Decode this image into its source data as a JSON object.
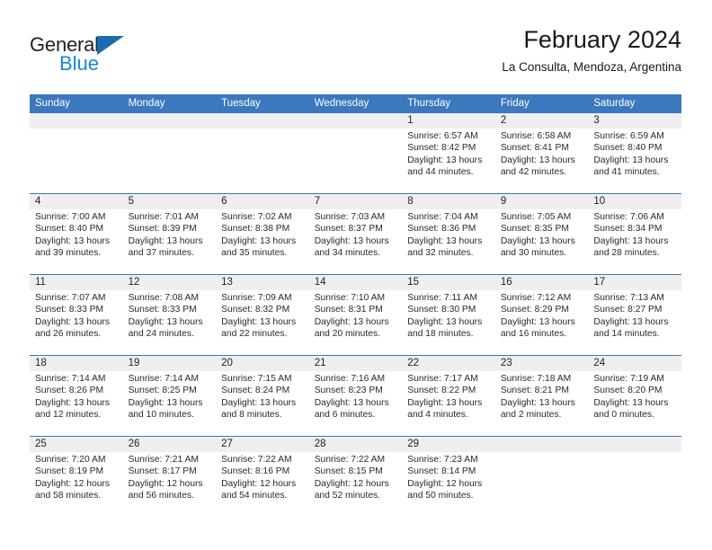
{
  "brand": {
    "name_part1": "General",
    "name_part2": "Blue",
    "triangle_icon": "brand-triangle-icon",
    "colors": {
      "dark": "#231f20",
      "blue": "#1b87d6",
      "triangle": "#1b6cb3"
    }
  },
  "header": {
    "title": "February 2024",
    "subtitle": "La Consulta, Mendoza, Argentina"
  },
  "theme": {
    "header_blue": "#3b78bd",
    "daynum_band": "#efefef",
    "grid_line": "#3b78bd"
  },
  "weekdays": [
    "Sunday",
    "Monday",
    "Tuesday",
    "Wednesday",
    "Thursday",
    "Friday",
    "Saturday"
  ],
  "weeks": [
    [
      {
        "day": "",
        "empty": true
      },
      {
        "day": "",
        "empty": true
      },
      {
        "day": "",
        "empty": true
      },
      {
        "day": "",
        "empty": true
      },
      {
        "day": "1",
        "sunrise": "Sunrise: 6:57 AM",
        "sunset": "Sunset: 8:42 PM",
        "daylight1": "Daylight: 13 hours",
        "daylight2": "and 44 minutes."
      },
      {
        "day": "2",
        "sunrise": "Sunrise: 6:58 AM",
        "sunset": "Sunset: 8:41 PM",
        "daylight1": "Daylight: 13 hours",
        "daylight2": "and 42 minutes."
      },
      {
        "day": "3",
        "sunrise": "Sunrise: 6:59 AM",
        "sunset": "Sunset: 8:40 PM",
        "daylight1": "Daylight: 13 hours",
        "daylight2": "and 41 minutes."
      }
    ],
    [
      {
        "day": "4",
        "sunrise": "Sunrise: 7:00 AM",
        "sunset": "Sunset: 8:40 PM",
        "daylight1": "Daylight: 13 hours",
        "daylight2": "and 39 minutes."
      },
      {
        "day": "5",
        "sunrise": "Sunrise: 7:01 AM",
        "sunset": "Sunset: 8:39 PM",
        "daylight1": "Daylight: 13 hours",
        "daylight2": "and 37 minutes."
      },
      {
        "day": "6",
        "sunrise": "Sunrise: 7:02 AM",
        "sunset": "Sunset: 8:38 PM",
        "daylight1": "Daylight: 13 hours",
        "daylight2": "and 35 minutes."
      },
      {
        "day": "7",
        "sunrise": "Sunrise: 7:03 AM",
        "sunset": "Sunset: 8:37 PM",
        "daylight1": "Daylight: 13 hours",
        "daylight2": "and 34 minutes."
      },
      {
        "day": "8",
        "sunrise": "Sunrise: 7:04 AM",
        "sunset": "Sunset: 8:36 PM",
        "daylight1": "Daylight: 13 hours",
        "daylight2": "and 32 minutes."
      },
      {
        "day": "9",
        "sunrise": "Sunrise: 7:05 AM",
        "sunset": "Sunset: 8:35 PM",
        "daylight1": "Daylight: 13 hours",
        "daylight2": "and 30 minutes."
      },
      {
        "day": "10",
        "sunrise": "Sunrise: 7:06 AM",
        "sunset": "Sunset: 8:34 PM",
        "daylight1": "Daylight: 13 hours",
        "daylight2": "and 28 minutes."
      }
    ],
    [
      {
        "day": "11",
        "sunrise": "Sunrise: 7:07 AM",
        "sunset": "Sunset: 8:33 PM",
        "daylight1": "Daylight: 13 hours",
        "daylight2": "and 26 minutes."
      },
      {
        "day": "12",
        "sunrise": "Sunrise: 7:08 AM",
        "sunset": "Sunset: 8:33 PM",
        "daylight1": "Daylight: 13 hours",
        "daylight2": "and 24 minutes."
      },
      {
        "day": "13",
        "sunrise": "Sunrise: 7:09 AM",
        "sunset": "Sunset: 8:32 PM",
        "daylight1": "Daylight: 13 hours",
        "daylight2": "and 22 minutes."
      },
      {
        "day": "14",
        "sunrise": "Sunrise: 7:10 AM",
        "sunset": "Sunset: 8:31 PM",
        "daylight1": "Daylight: 13 hours",
        "daylight2": "and 20 minutes."
      },
      {
        "day": "15",
        "sunrise": "Sunrise: 7:11 AM",
        "sunset": "Sunset: 8:30 PM",
        "daylight1": "Daylight: 13 hours",
        "daylight2": "and 18 minutes."
      },
      {
        "day": "16",
        "sunrise": "Sunrise: 7:12 AM",
        "sunset": "Sunset: 8:29 PM",
        "daylight1": "Daylight: 13 hours",
        "daylight2": "and 16 minutes."
      },
      {
        "day": "17",
        "sunrise": "Sunrise: 7:13 AM",
        "sunset": "Sunset: 8:27 PM",
        "daylight1": "Daylight: 13 hours",
        "daylight2": "and 14 minutes."
      }
    ],
    [
      {
        "day": "18",
        "sunrise": "Sunrise: 7:14 AM",
        "sunset": "Sunset: 8:26 PM",
        "daylight1": "Daylight: 13 hours",
        "daylight2": "and 12 minutes."
      },
      {
        "day": "19",
        "sunrise": "Sunrise: 7:14 AM",
        "sunset": "Sunset: 8:25 PM",
        "daylight1": "Daylight: 13 hours",
        "daylight2": "and 10 minutes."
      },
      {
        "day": "20",
        "sunrise": "Sunrise: 7:15 AM",
        "sunset": "Sunset: 8:24 PM",
        "daylight1": "Daylight: 13 hours",
        "daylight2": "and 8 minutes."
      },
      {
        "day": "21",
        "sunrise": "Sunrise: 7:16 AM",
        "sunset": "Sunset: 8:23 PM",
        "daylight1": "Daylight: 13 hours",
        "daylight2": "and 6 minutes."
      },
      {
        "day": "22",
        "sunrise": "Sunrise: 7:17 AM",
        "sunset": "Sunset: 8:22 PM",
        "daylight1": "Daylight: 13 hours",
        "daylight2": "and 4 minutes."
      },
      {
        "day": "23",
        "sunrise": "Sunrise: 7:18 AM",
        "sunset": "Sunset: 8:21 PM",
        "daylight1": "Daylight: 13 hours",
        "daylight2": "and 2 minutes."
      },
      {
        "day": "24",
        "sunrise": "Sunrise: 7:19 AM",
        "sunset": "Sunset: 8:20 PM",
        "daylight1": "Daylight: 13 hours",
        "daylight2": "and 0 minutes."
      }
    ],
    [
      {
        "day": "25",
        "sunrise": "Sunrise: 7:20 AM",
        "sunset": "Sunset: 8:19 PM",
        "daylight1": "Daylight: 12 hours",
        "daylight2": "and 58 minutes."
      },
      {
        "day": "26",
        "sunrise": "Sunrise: 7:21 AM",
        "sunset": "Sunset: 8:17 PM",
        "daylight1": "Daylight: 12 hours",
        "daylight2": "and 56 minutes."
      },
      {
        "day": "27",
        "sunrise": "Sunrise: 7:22 AM",
        "sunset": "Sunset: 8:16 PM",
        "daylight1": "Daylight: 12 hours",
        "daylight2": "and 54 minutes."
      },
      {
        "day": "28",
        "sunrise": "Sunrise: 7:22 AM",
        "sunset": "Sunset: 8:15 PM",
        "daylight1": "Daylight: 12 hours",
        "daylight2": "and 52 minutes."
      },
      {
        "day": "29",
        "sunrise": "Sunrise: 7:23 AM",
        "sunset": "Sunset: 8:14 PM",
        "daylight1": "Daylight: 12 hours",
        "daylight2": "and 50 minutes."
      },
      {
        "day": "",
        "empty": true
      },
      {
        "day": "",
        "empty": true
      }
    ]
  ]
}
